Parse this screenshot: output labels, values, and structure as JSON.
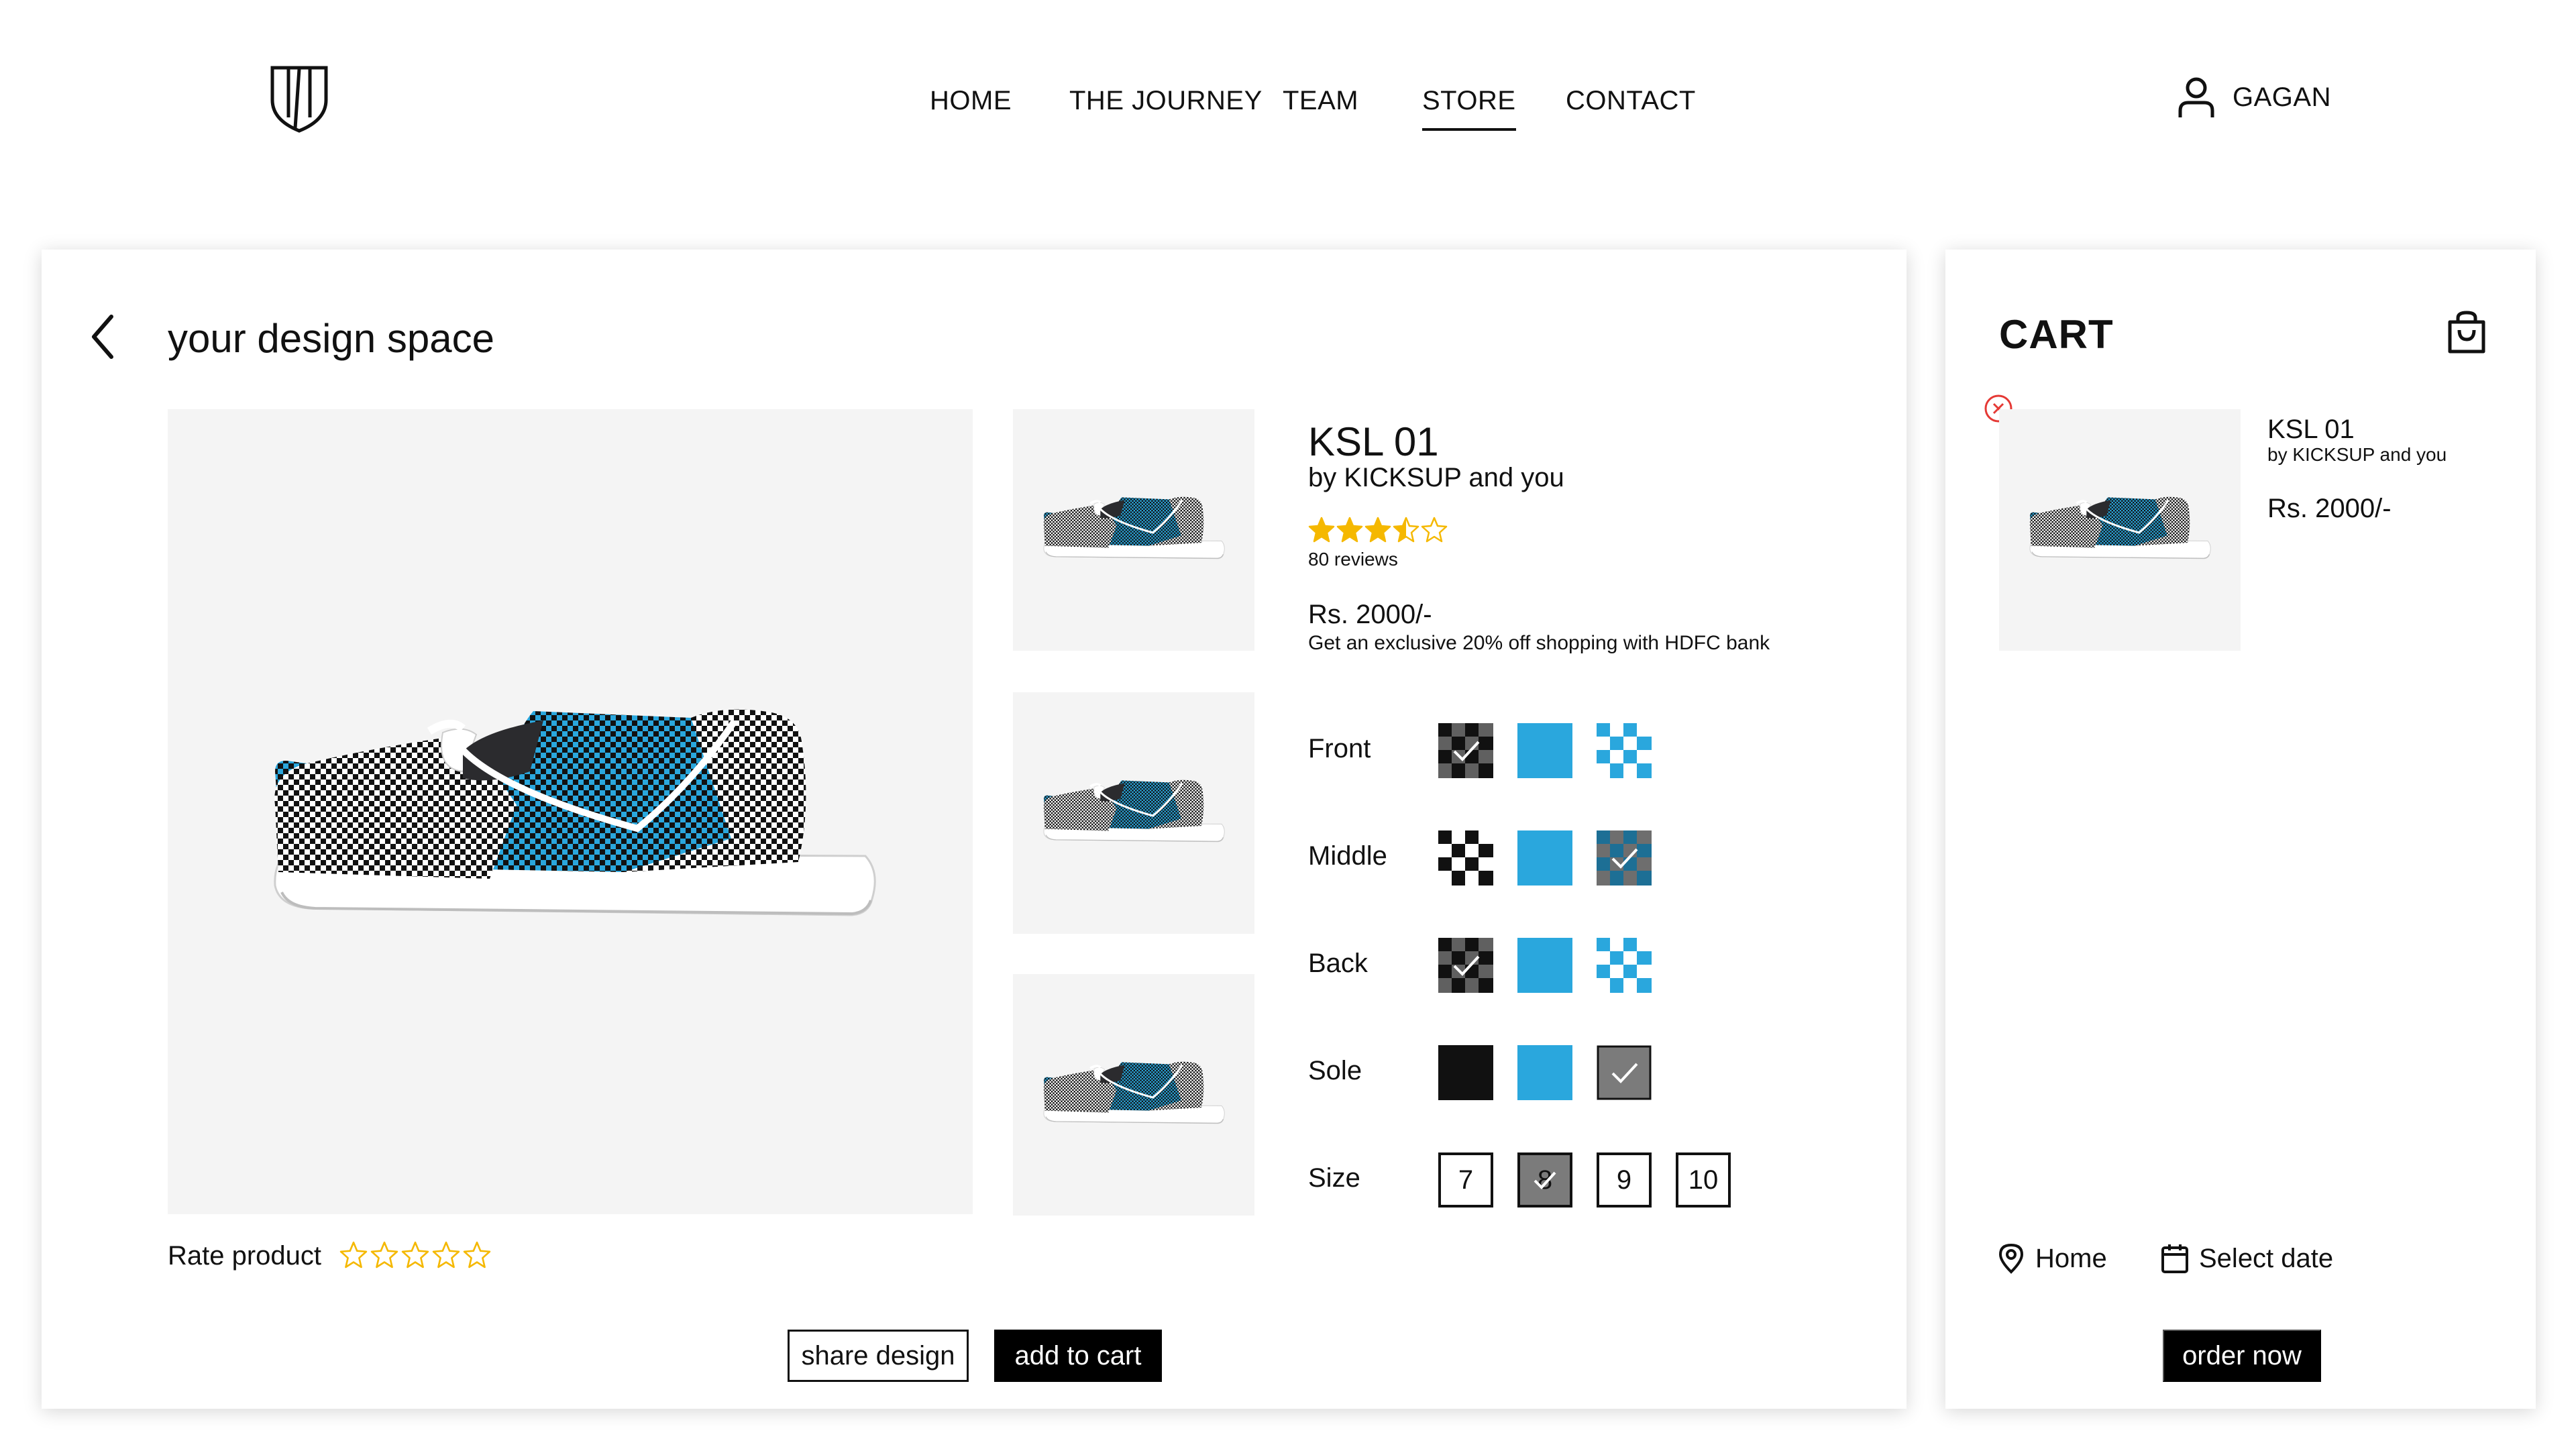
{
  "nav": {
    "items": [
      "HOME",
      "THE JOURNEY",
      "TEAM",
      "STORE",
      "CONTACT"
    ],
    "active": "STORE"
  },
  "user": {
    "name": "GAGAN",
    "icon": "user-icon"
  },
  "design": {
    "title": "your design space",
    "product": {
      "name": "KSL 01",
      "by": "by KICKSUP and you",
      "rating": 3.5,
      "rating_max": 5,
      "reviews": "80 reviews",
      "price": "Rs. 2000/-",
      "offer": "Get an exclusive 20% off shopping with HDFC bank"
    },
    "options": {
      "front_label": "Front",
      "middle_label": "Middle",
      "back_label": "Back",
      "sole_label": "Sole",
      "size_label": "Size",
      "sizes": [
        "7",
        "8",
        "9",
        "10"
      ],
      "selected_size": "8"
    },
    "rate_label": "Rate product",
    "share_label": "share design",
    "add_to_cart_label": "add to cart"
  },
  "cart": {
    "title": "CART",
    "item": {
      "name": "KSL 01",
      "by": "by KICKSUP and you",
      "price": "Rs. 2000/-"
    },
    "location": "Home",
    "date_label": "Select date",
    "order_label": "order now"
  },
  "colors": {
    "accent_blue": "#2aa7dd",
    "star": "#f5b800",
    "remove": "#e53935",
    "black": "#111111",
    "panel_bg": "#f4f4f4"
  }
}
